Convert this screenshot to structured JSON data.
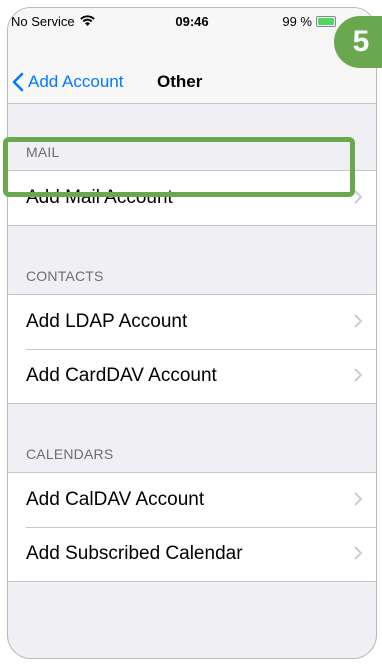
{
  "status_bar": {
    "carrier": "No Service",
    "time": "09:46",
    "battery_text": "99 %",
    "battery_level": 0.99
  },
  "nav": {
    "back_label": "Add Account",
    "title": "Other"
  },
  "sections": [
    {
      "header": "MAIL",
      "rows": [
        "Add Mail Account"
      ]
    },
    {
      "header": "CONTACTS",
      "rows": [
        "Add LDAP Account",
        "Add CardDAV Account"
      ]
    },
    {
      "header": "CALENDARS",
      "rows": [
        "Add CalDAV Account",
        "Add Subscribed Calendar"
      ]
    }
  ],
  "annotation": {
    "step_number": "5"
  },
  "colors": {
    "ios_blue": "#007aff",
    "highlight_green": "#6aa84f",
    "group_background": "#efeff4"
  },
  "icons": [
    "wifi-icon",
    "battery-icon",
    "back-chevron-icon",
    "chevron-right-icon"
  ]
}
